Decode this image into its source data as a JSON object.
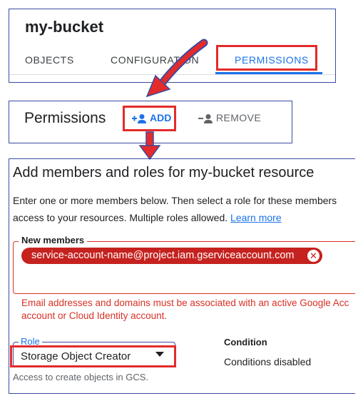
{
  "bucket": {
    "title": "my-bucket",
    "tabs": [
      {
        "label": "OBJECTS"
      },
      {
        "label": "CONFIGURATION"
      },
      {
        "label": "PERMISSIONS",
        "active": true
      }
    ]
  },
  "permissions": {
    "title": "Permissions",
    "add_label": "ADD",
    "remove_label": "REMOVE"
  },
  "dialog": {
    "title": "Add members and roles for my-bucket resource",
    "description_line1": "Enter one or more members below. Then select a role for these members",
    "description_line2": "access to your resources. Multiple roles allowed.",
    "learn_more": "Learn more",
    "members_label": "New members",
    "member_chip": "service-account-name@project.iam.gserviceaccount.com",
    "error_line1": "Email addresses and domains must be associated with an active Google Acc",
    "error_line2": "account or Cloud Identity account.",
    "role_label": "Role",
    "role_value": "Storage Object Creator",
    "role_help": "Access to create objects in GCS.",
    "condition_label": "Condition",
    "condition_value": "Conditions disabled"
  },
  "colors": {
    "accent": "#1a73e8",
    "highlight": "#e32b2b",
    "panel_border": "#3b4ba0",
    "error": "#d93025",
    "chip": "#c5221f"
  },
  "icons": [
    "add-person-icon",
    "remove-person-icon",
    "dropdown-caret-icon",
    "chip-close-icon",
    "annotation-arrow"
  ]
}
